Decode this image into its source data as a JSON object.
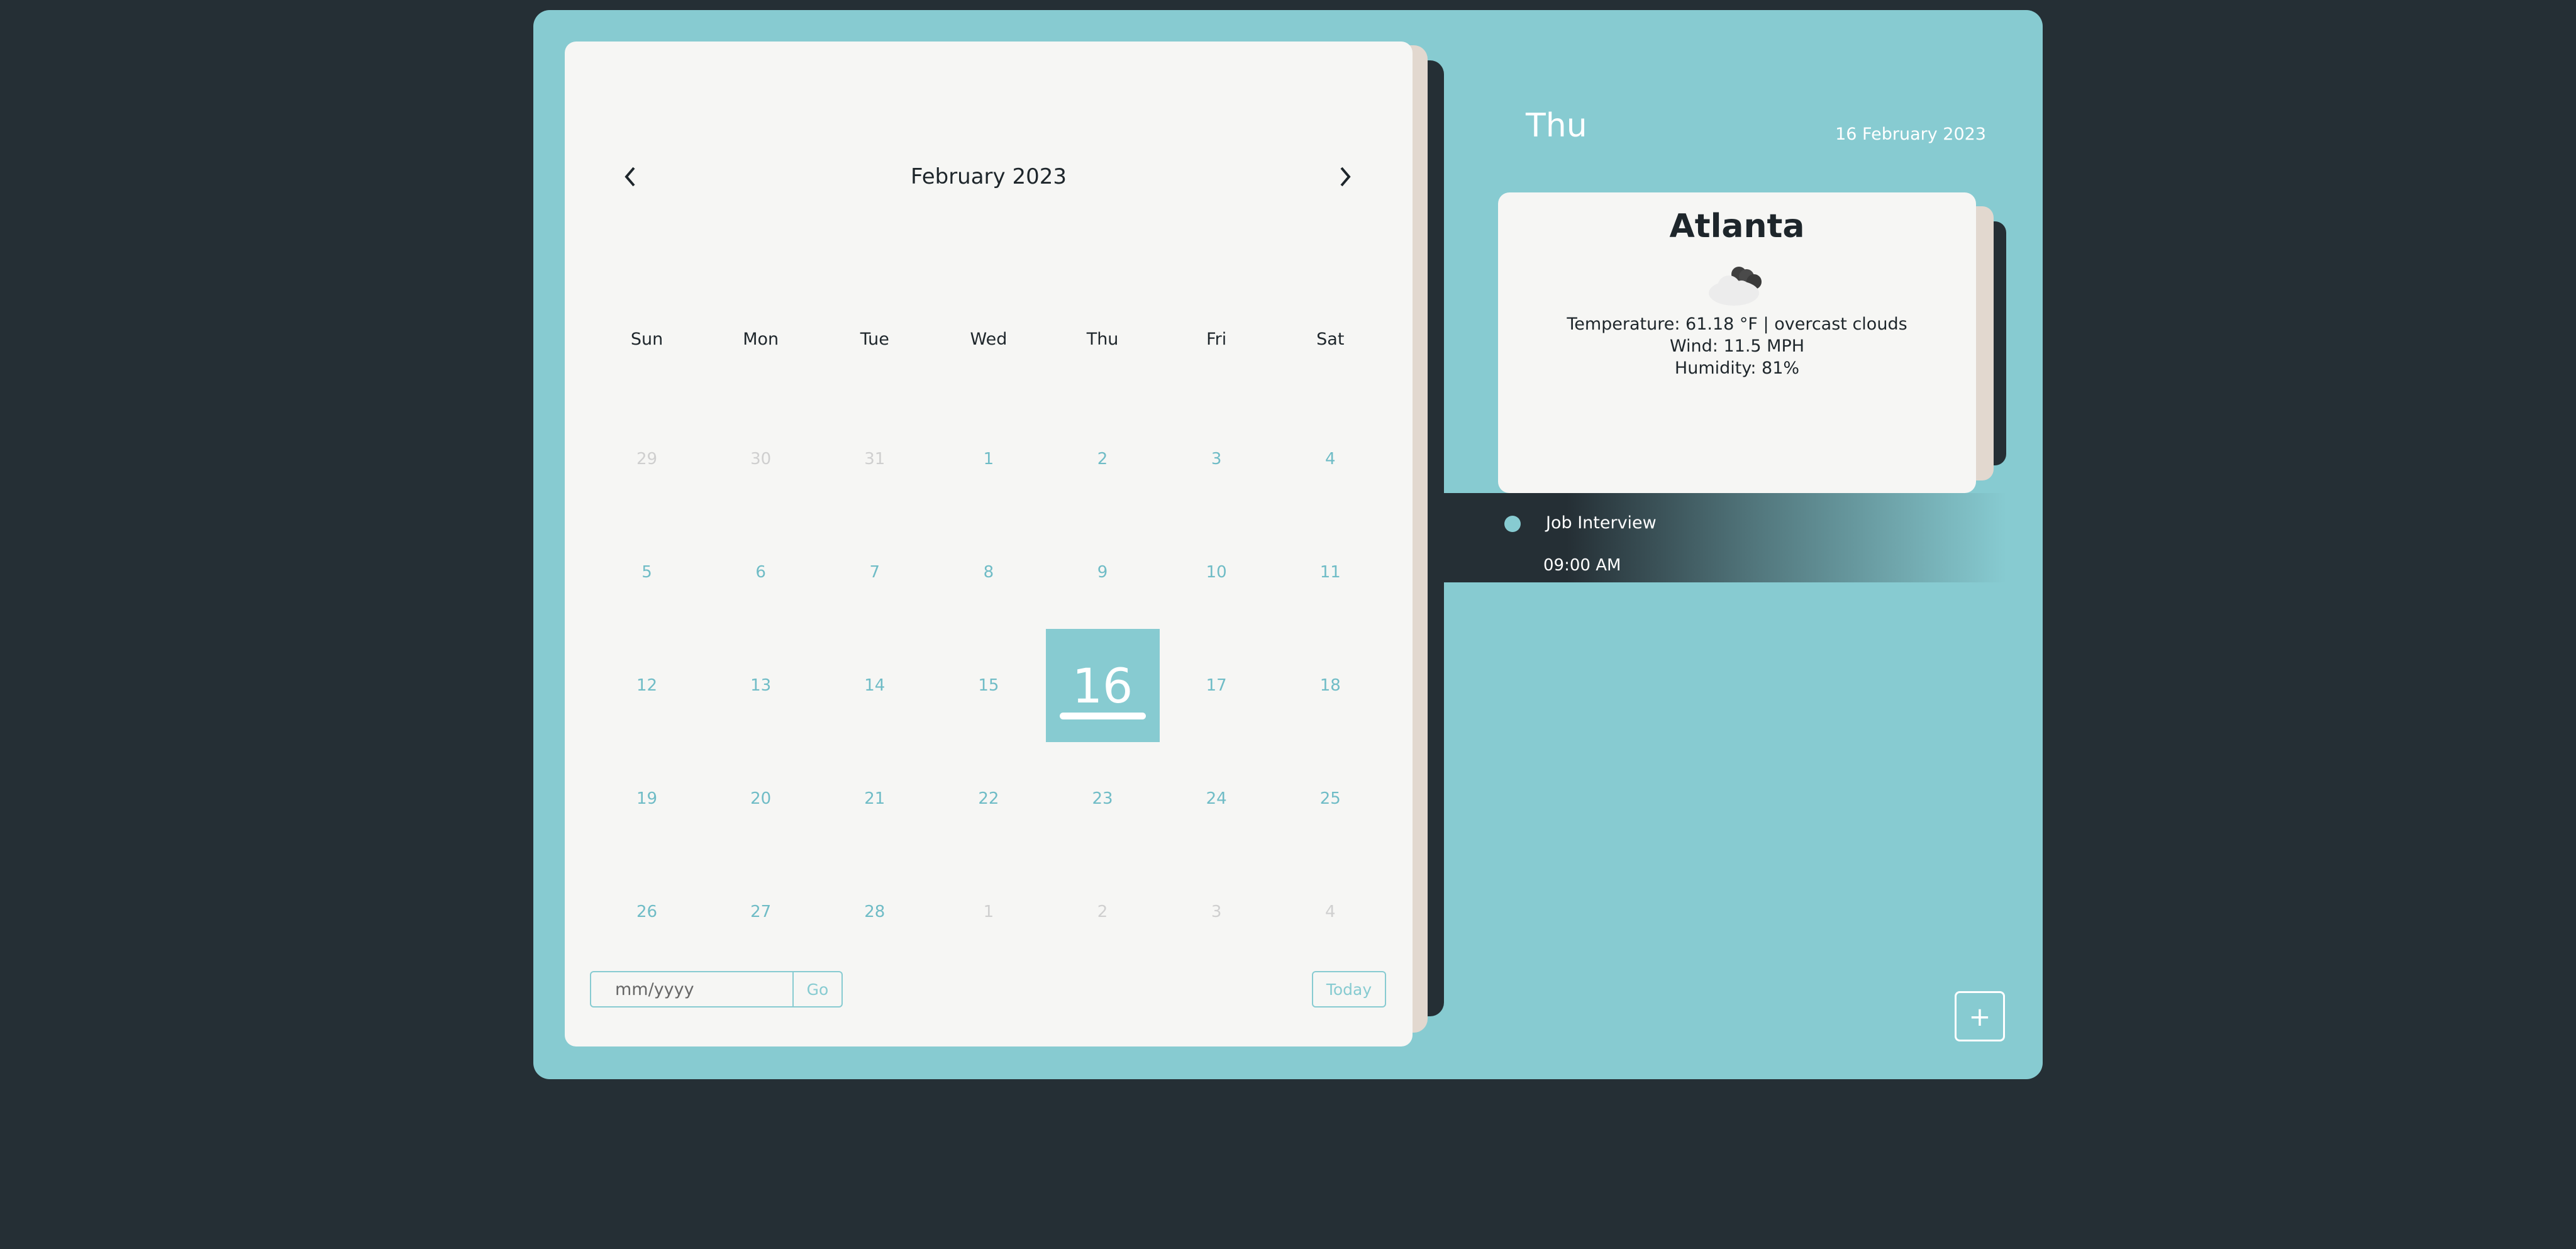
{
  "calendar": {
    "month_title": "February 2023",
    "prev_icon": "chevron-left-icon",
    "next_icon": "chevron-right-icon",
    "weekdays": [
      "Sun",
      "Mon",
      "Tue",
      "Wed",
      "Thu",
      "Fri",
      "Sat"
    ],
    "weeks": [
      [
        {
          "d": "29",
          "muted": true
        },
        {
          "d": "30",
          "muted": true
        },
        {
          "d": "31",
          "muted": true
        },
        {
          "d": "1"
        },
        {
          "d": "2"
        },
        {
          "d": "3"
        },
        {
          "d": "4"
        }
      ],
      [
        {
          "d": "5"
        },
        {
          "d": "6"
        },
        {
          "d": "7"
        },
        {
          "d": "8"
        },
        {
          "d": "9"
        },
        {
          "d": "10"
        },
        {
          "d": "11"
        }
      ],
      [
        {
          "d": "12"
        },
        {
          "d": "13"
        },
        {
          "d": "14"
        },
        {
          "d": "15"
        },
        {
          "d": "16",
          "selected": true
        },
        {
          "d": "17"
        },
        {
          "d": "18"
        }
      ],
      [
        {
          "d": "19"
        },
        {
          "d": "20"
        },
        {
          "d": "21"
        },
        {
          "d": "22"
        },
        {
          "d": "23"
        },
        {
          "d": "24"
        },
        {
          "d": "25"
        }
      ],
      [
        {
          "d": "26"
        },
        {
          "d": "27"
        },
        {
          "d": "28"
        },
        {
          "d": "1",
          "muted": true
        },
        {
          "d": "2",
          "muted": true
        },
        {
          "d": "3",
          "muted": true
        },
        {
          "d": "4",
          "muted": true
        }
      ]
    ],
    "date_input": {
      "placeholder": "mm/yyyy",
      "value": ""
    },
    "go_label": "Go",
    "today_label": "Today"
  },
  "side": {
    "day_name": "Thu",
    "full_date": "16 February 2023"
  },
  "weather": {
    "city": "Atlanta",
    "icon": "overcast-clouds-icon",
    "temperature": "Temperature: 61.18 °F | overcast clouds",
    "wind": "Wind: 11.5 MPH",
    "humidity": "Humidity: 81%"
  },
  "events": [
    {
      "title": "Job Interview",
      "time": "09:00 AM"
    }
  ],
  "add_button_label": "+",
  "colors": {
    "background": "#252f35",
    "accent": "#87cbd1",
    "card": "#f6f6f4",
    "muted_day": "#cfcfcf"
  }
}
